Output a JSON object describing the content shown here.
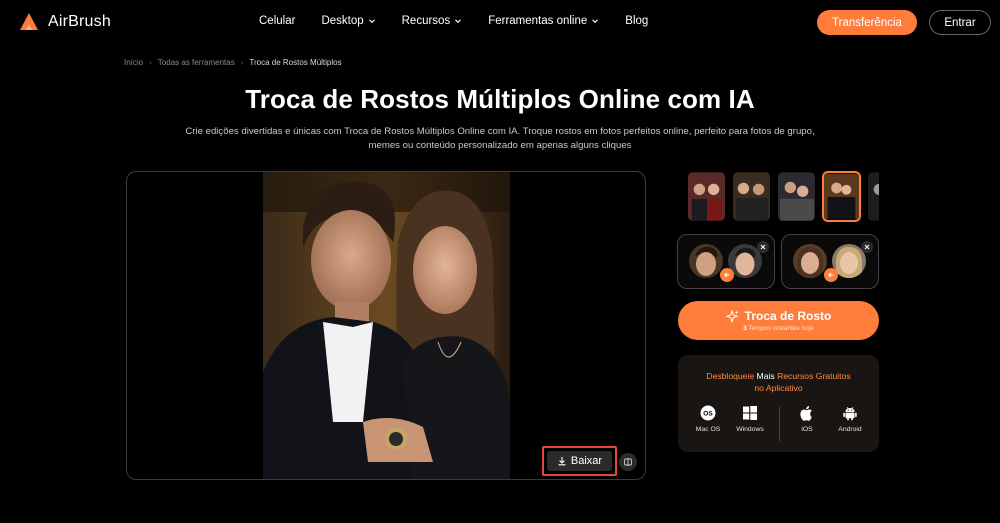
{
  "brand": {
    "name": "AirBrush",
    "accent": "#ff7d3b"
  },
  "nav": {
    "items": [
      {
        "label": "Celular",
        "dropdown": false
      },
      {
        "label": "Desktop",
        "dropdown": true
      },
      {
        "label": "Recursos",
        "dropdown": true
      },
      {
        "label": "Ferramentas online",
        "dropdown": true
      },
      {
        "label": "Blog",
        "dropdown": false
      }
    ],
    "transfer_label": "Transferência",
    "login_label": "Entrar"
  },
  "breadcrumb": [
    "Início",
    "Todas as ferramentas",
    "Troca de Rostos Múltiplos"
  ],
  "page": {
    "title": "Troca de Rostos Múltiplos Online com IA",
    "subtitle_line1": "Crie edições divertidas e únicas com Troca de Rostos Múltiplos Online com IA. Troque rostos em fotos perfeitos online, perfeito para fotos de grupo,",
    "subtitle_line2": "memes ou conteúdo personalizado em apenas alguns cliques"
  },
  "canvas": {
    "download_label": "Baixar",
    "download_icon": "download-icon",
    "compare_icon": "compare-icon"
  },
  "templates": {
    "count_visible": 5,
    "selected_index": 3
  },
  "swap": {
    "button_label": "Troca de Rosto",
    "remaining_count": "3",
    "remaining_text": "Tempos restantes hoje"
  },
  "promo": {
    "title_part1": "Desbloqueie ",
    "title_part2": "Mais",
    "title_part3": " Recursos Gratuitos",
    "title_line2": "no Aplicativo",
    "platforms": [
      {
        "label": "Mac OS",
        "icon": "macos-icon"
      },
      {
        "label": "Windows",
        "icon": "windows-icon"
      },
      {
        "label": "iOS",
        "icon": "apple-icon"
      },
      {
        "label": "Android",
        "icon": "android-icon"
      }
    ]
  }
}
